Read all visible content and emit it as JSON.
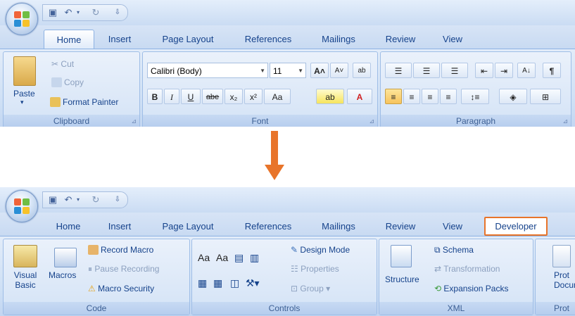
{
  "top": {
    "tabs": [
      "Home",
      "Insert",
      "Page Layout",
      "References",
      "Mailings",
      "Review",
      "View"
    ],
    "clipboard": {
      "paste": "Paste",
      "cut": "Cut",
      "copy": "Copy",
      "format_painter": "Format Painter",
      "label": "Clipboard"
    },
    "font": {
      "name": "Calibri (Body)",
      "size": "11",
      "label": "Font",
      "buttons": [
        "B",
        "I",
        "U",
        "abe",
        "x₂",
        "x²",
        "Aa"
      ]
    },
    "paragraph": {
      "label": "Paragraph"
    }
  },
  "bottom": {
    "tabs": [
      "Home",
      "Insert",
      "Page Layout",
      "References",
      "Mailings",
      "Review",
      "View",
      "Developer"
    ],
    "code": {
      "visual_basic_1": "Visual",
      "visual_basic_2": "Basic",
      "macros": "Macros",
      "record_macro": "Record Macro",
      "pause_recording": "Pause Recording",
      "macro_security": "Macro Security",
      "label": "Code"
    },
    "controls": {
      "aa1": "Aa",
      "aa2": "Aa",
      "design_mode": "Design Mode",
      "properties": "Properties",
      "group": "Group",
      "label": "Controls"
    },
    "xml": {
      "structure": "Structure",
      "schema": "Schema",
      "transformation": "Transformation",
      "expansion_packs": "Expansion Packs",
      "label": "XML"
    },
    "protect": {
      "line1": "Prot",
      "line2": "Docum",
      "label": "Prot"
    }
  },
  "colors": {
    "accent": "#e8742a",
    "ribbon": "#cddff5",
    "text": "#15428b"
  }
}
